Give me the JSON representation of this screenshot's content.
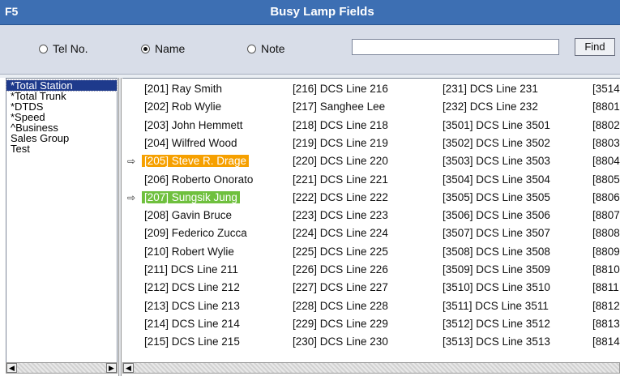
{
  "window": {
    "app_id": "F5",
    "title": "Busy Lamp Fields"
  },
  "search": {
    "options": [
      {
        "label": "Tel No.",
        "selected": false
      },
      {
        "label": "Name",
        "selected": true
      },
      {
        "label": "Note",
        "selected": false
      }
    ],
    "value": "",
    "find_label": "Find"
  },
  "groups": [
    {
      "label": "*Total Station",
      "selected": true
    },
    {
      "label": "*Total Trunk",
      "selected": false
    },
    {
      "label": "*DTDS",
      "selected": false
    },
    {
      "label": "*Speed",
      "selected": false
    },
    {
      "label": "^Business",
      "selected": false
    },
    {
      "label": "Sales Group",
      "selected": false
    },
    {
      "label": "Test",
      "selected": false
    }
  ],
  "columns": [
    [
      {
        "label": "[201] Ray Smith"
      },
      {
        "label": "[202] Rob Wylie"
      },
      {
        "label": "[203] John Hemmett"
      },
      {
        "label": "[204] Wilfred Wood"
      },
      {
        "label": "[205] Steve R. Drage",
        "status": "busy",
        "forward": "forward-icon"
      },
      {
        "label": "[206] Roberto Onorato"
      },
      {
        "label": "[207] Sungsik Jung",
        "status": "green",
        "forward": "forward-icon"
      },
      {
        "label": "[208] Gavin Bruce"
      },
      {
        "label": "[209] Federico Zucca"
      },
      {
        "label": "[210] Robert Wylie"
      },
      {
        "label": "[211] DCS Line 211"
      },
      {
        "label": "[212] DCS Line 212"
      },
      {
        "label": "[213] DCS Line 213"
      },
      {
        "label": "[214] DCS Line 214"
      },
      {
        "label": "[215] DCS Line 215"
      }
    ],
    [
      {
        "label": "[216] DCS Line 216"
      },
      {
        "label": "[217] Sanghee Lee"
      },
      {
        "label": "[218] DCS Line 218"
      },
      {
        "label": "[219] DCS Line 219"
      },
      {
        "label": "[220] DCS Line 220"
      },
      {
        "label": "[221] DCS Line 221"
      },
      {
        "label": "[222] DCS Line 222"
      },
      {
        "label": "[223] DCS Line 223"
      },
      {
        "label": "[224] DCS Line 224"
      },
      {
        "label": "[225] DCS Line 225"
      },
      {
        "label": "[226] DCS Line 226"
      },
      {
        "label": "[227] DCS Line 227"
      },
      {
        "label": "[228] DCS Line 228"
      },
      {
        "label": "[229] DCS Line 229"
      },
      {
        "label": "[230] DCS Line 230"
      }
    ],
    [
      {
        "label": "[231] DCS Line 231"
      },
      {
        "label": "[232] DCS Line 232"
      },
      {
        "label": "[3501] DCS Line 3501"
      },
      {
        "label": "[3502] DCS Line 3502"
      },
      {
        "label": "[3503] DCS Line 3503"
      },
      {
        "label": "[3504] DCS Line 3504"
      },
      {
        "label": "[3505] DCS Line 3505"
      },
      {
        "label": "[3506] DCS Line 3506"
      },
      {
        "label": "[3507] DCS Line 3507"
      },
      {
        "label": "[3508] DCS Line 3508"
      },
      {
        "label": "[3509] DCS Line 3509"
      },
      {
        "label": "[3510] DCS Line 3510"
      },
      {
        "label": "[3511] DCS Line 3511"
      },
      {
        "label": "[3512] DCS Line 3512"
      },
      {
        "label": "[3513] DCS Line 3513"
      }
    ],
    [
      {
        "label": "[3514"
      },
      {
        "label": "[8801"
      },
      {
        "label": "[8802"
      },
      {
        "label": "[8803"
      },
      {
        "label": "[8804"
      },
      {
        "label": "[8805"
      },
      {
        "label": "[8806"
      },
      {
        "label": "[8807"
      },
      {
        "label": "[8808"
      },
      {
        "label": "[8809"
      },
      {
        "label": "[8810"
      },
      {
        "label": "[8811"
      },
      {
        "label": "[8812"
      },
      {
        "label": "[8813"
      },
      {
        "label": "[8814"
      }
    ]
  ],
  "colors": {
    "title_bar": "#3d6fb3",
    "busy": "#f6a000",
    "green": "#6fc03e",
    "selected_group": "#1e3a8c"
  }
}
